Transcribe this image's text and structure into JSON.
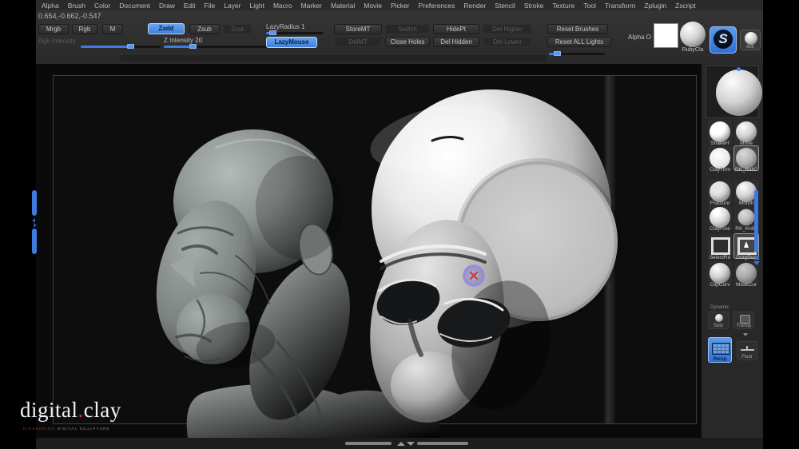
{
  "menu": {
    "items": [
      "Alpha",
      "Brush",
      "Color",
      "Document",
      "Draw",
      "Edit",
      "File",
      "Layer",
      "Light",
      "Macro",
      "Marker",
      "Material",
      "Movie",
      "Picker",
      "Preferences",
      "Render",
      "Stencil",
      "Stroke",
      "Texture",
      "Tool",
      "Transform",
      "Zplugin",
      "Zscript"
    ]
  },
  "shelf": {
    "coords": "0.654,-0.662,-0.547",
    "mrgb": "Mrgb",
    "rgb": "Rgb",
    "m": "M",
    "zadd": "Zadd",
    "zsub": "Zsub",
    "zcut": "Zcut",
    "rgb_intensity": "Rgb Intensity",
    "z_intensity": "Z Intensity 20",
    "lazy_radius": "LazyRadius 1",
    "lazy_mouse": "LazyMouse",
    "store_mt": "StoreMT",
    "switch": "Switch",
    "hide_pt": "HidePt",
    "del_higher": "Del Higher",
    "del_mt": "DelMT",
    "close_holes": "Close Holes",
    "del_hidden": "Del Hidden",
    "del_lower": "Del Lower",
    "reset_brushes": "Reset Brushes",
    "reset_all_lights": "Reset ALL Lights",
    "alpha_label": "Alpha O",
    "material_label": "RubyCla",
    "brush_icon_glyph": "S",
    "brush_b_label": "BriB"
  },
  "right_shelf": {
    "brushes": [
      {
        "name": "SnakeH"
      },
      {
        "name": "Move"
      },
      {
        "name": "ClayTrim"
      },
      {
        "name": "RK_BallC"
      },
      {
        "name": "Fracture"
      },
      {
        "name": "Morph"
      },
      {
        "name": "ClayFine"
      },
      {
        "name": "RK_Knife"
      },
      {
        "name": "SelectRe"
      },
      {
        "name": "DragRec"
      },
      {
        "name": "ClipCurv"
      },
      {
        "name": "MaskCur"
      }
    ],
    "dynamic_label": "Dynamic",
    "solo": "Solo",
    "transp": "Transp",
    "persp": "Persp",
    "floor": "Floor"
  },
  "watermark": {
    "title_left": "digital",
    "title_dot": ".",
    "title_right": "clay",
    "tagline_accent": "PIONEERING",
    "tagline": "DIGITAL SCULPTURE"
  },
  "colors": {
    "accent_blue": "#3d7be0",
    "cursor_red": "#c23838",
    "cursor_purple": "#988cdc",
    "canvas_bg": "#0a0a0a",
    "panel_bg": "#282828"
  }
}
